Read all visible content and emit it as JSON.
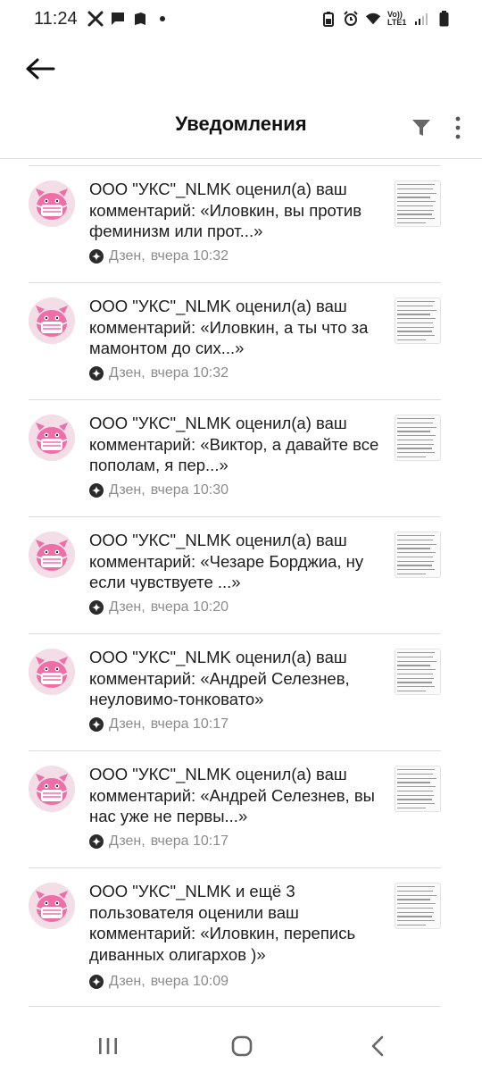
{
  "status_bar": {
    "time": "11:24",
    "network_label": "Vo)) LTE1",
    "left_icons": [
      "tools-icon",
      "chat-icon",
      "book-icon",
      "dot-icon"
    ],
    "right_icons": [
      "battery-saver-icon",
      "alarm-icon",
      "wifi-icon",
      "signal-icon",
      "battery-icon"
    ]
  },
  "header": {
    "title": "Уведомления",
    "back_icon": "arrow-left-icon",
    "filter_icon": "filter-icon",
    "more_icon": "more-vertical-icon"
  },
  "notifications": [
    {
      "text": "ООО \"УКС\"_NLMK оценил(а) ваш комментарий: «Иловкин, вы против феминизм или прот...»",
      "source": "Дзен",
      "time": "вчера 10:32"
    },
    {
      "text": "ООО \"УКС\"_NLMK оценил(а) ваш комментарий: «Иловкин, а ты что за мамонтом до сих...»",
      "source": "Дзен",
      "time": "вчера 10:32"
    },
    {
      "text": "ООО \"УКС\"_NLMK оценил(а) ваш комментарий: «Виктор, а давайте все пополам, я пер...»",
      "source": "Дзен",
      "time": "вчера 10:30"
    },
    {
      "text": "ООО \"УКС\"_NLMK оценил(а) ваш комментарий: «Чезаре Борджиа, ну если чувствуете ...»",
      "source": "Дзен",
      "time": "вчера 10:20"
    },
    {
      "text": "ООО \"УКС\"_NLMK оценил(а) ваш комментарий: «Андрей Селезнев, неуловимо-тонковато»",
      "source": "Дзен",
      "time": "вчера 10:17"
    },
    {
      "text": "ООО \"УКС\"_NLMK оценил(а) ваш комментарий: «Андрей Селезнев, вы нас уже не первы...»",
      "source": "Дзен",
      "time": "вчера 10:17"
    },
    {
      "text": "ООО \"УКС\"_NLMK и ещё 3 пользователя оценили ваш комментарий: «Иловкин, перепись диванных олигархов )»",
      "source": "Дзен",
      "time": "вчера 10:09"
    }
  ],
  "nav_bar": {
    "icons": [
      "recent-apps-icon",
      "home-icon",
      "back-icon"
    ]
  },
  "colors": {
    "avatar_pink": "#ee6fa7",
    "avatar_bg": "#f3dde6",
    "meta_gray": "#8c8c8c"
  }
}
